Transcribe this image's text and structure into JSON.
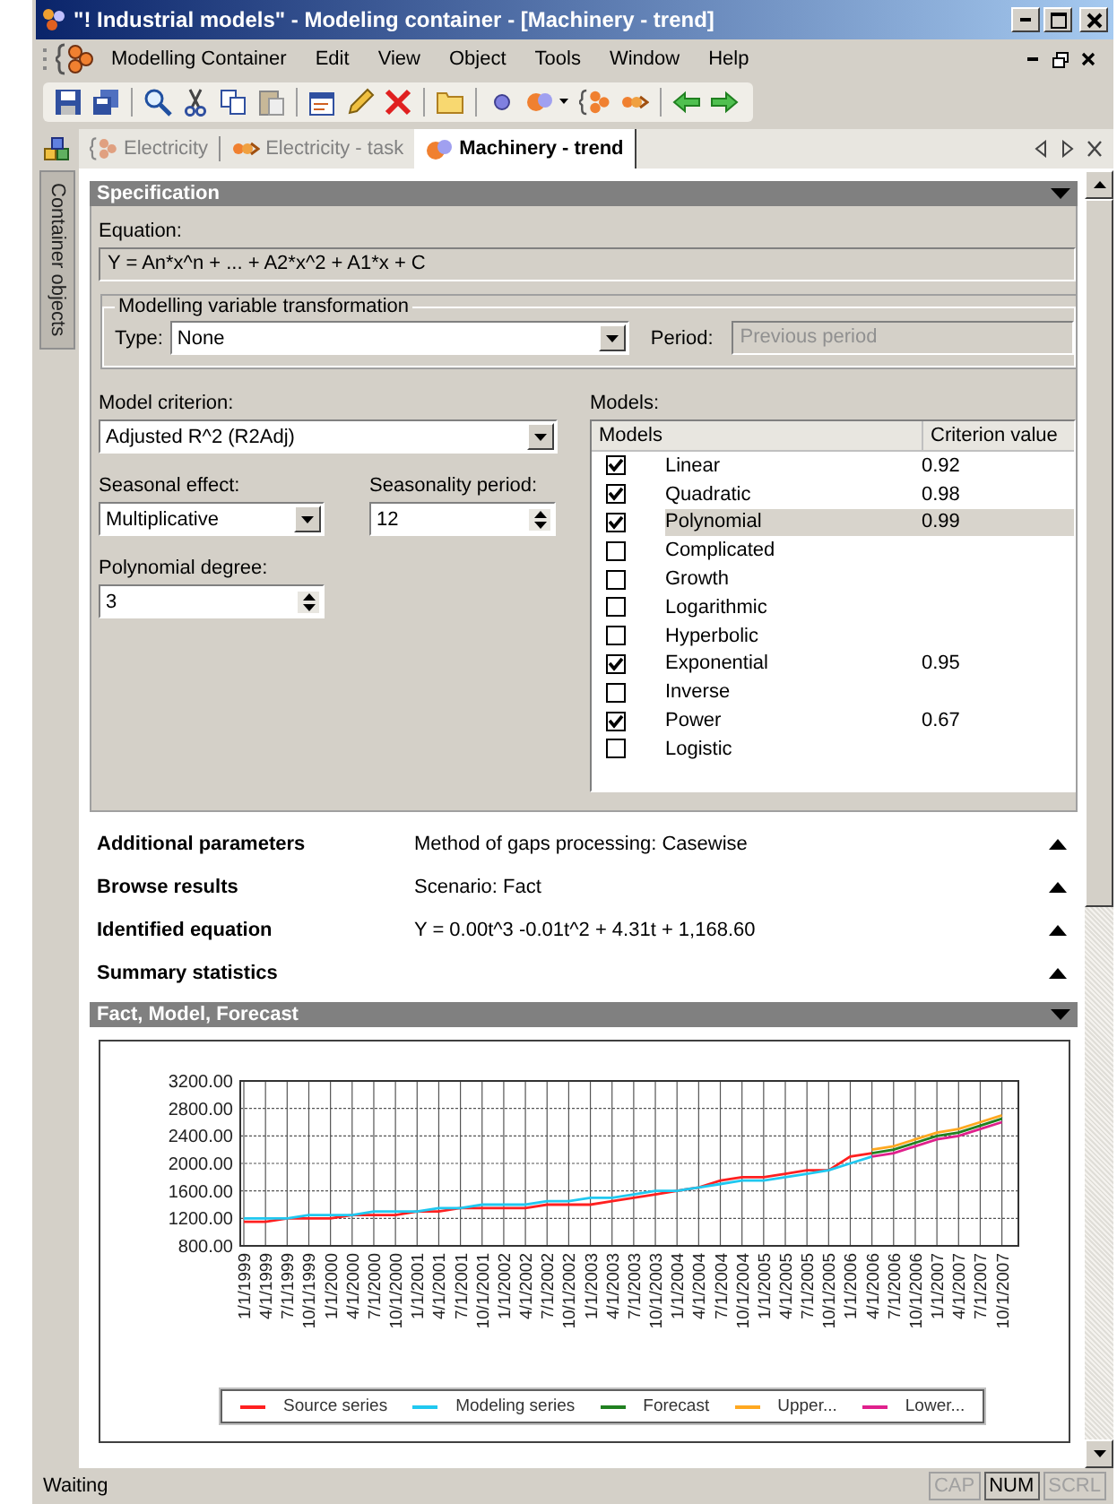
{
  "window": {
    "title": "\"! Industrial models\" - Modeling container - [Machinery - trend]"
  },
  "menu": [
    "Modelling Container",
    "Edit",
    "View",
    "Object",
    "Tools",
    "Window",
    "Help"
  ],
  "side_tab": "Container objects",
  "tabs": [
    {
      "label": "Electricity",
      "selected": false
    },
    {
      "label": "Electricity - task",
      "selected": false
    },
    {
      "label": "Machinery - trend",
      "selected": true
    }
  ],
  "specification": {
    "title": "Specification",
    "equation_label": "Equation:",
    "equation": "Y = An*x^n + ... + A2*x^2 + A1*x + C",
    "transformation": {
      "legend": "Modelling variable transformation",
      "type_label": "Type:",
      "type": "None",
      "period_label": "Period:",
      "period": "Previous period",
      "period_disabled": true
    },
    "criterion_label": "Model criterion:",
    "criterion": "Adjusted R^2 (R2Adj)",
    "seasonal_label": "Seasonal effect:",
    "seasonal": "Multiplicative",
    "seasonality_label": "Seasonality period:",
    "seasonality_period": "12",
    "degree_label": "Polynomial degree:",
    "degree": "3",
    "models_label": "Models:",
    "models_columns": [
      "Models",
      "Criterion value"
    ],
    "models": [
      {
        "name": "Linear",
        "checked": true,
        "selected": false,
        "value": "0.92"
      },
      {
        "name": "Quadratic",
        "checked": true,
        "selected": false,
        "value": "0.98"
      },
      {
        "name": "Polynomial",
        "checked": true,
        "selected": true,
        "value": "0.99"
      },
      {
        "name": "Complicated",
        "checked": false,
        "selected": false
      },
      {
        "name": "Growth",
        "checked": false,
        "selected": false
      },
      {
        "name": "Logarithmic",
        "checked": false,
        "selected": false
      },
      {
        "name": "Hyperbolic",
        "checked": false,
        "selected": false
      },
      {
        "name": "Exponential",
        "checked": true,
        "selected": false,
        "value": "0.95"
      },
      {
        "name": "Inverse",
        "checked": false,
        "selected": false
      },
      {
        "name": "Power",
        "checked": true,
        "selected": false,
        "value": "0.67"
      },
      {
        "name": "Logistic",
        "checked": false,
        "selected": false
      }
    ]
  },
  "sections": [
    {
      "title": "Additional parameters",
      "summary": "Method of gaps processing: Casewise"
    },
    {
      "title": "Browse results",
      "summary": "Scenario: Fact"
    },
    {
      "title": "Identified equation",
      "summary": "Y = 0.00t^3 -0.01t^2 + 4.31t + 1,168.60"
    },
    {
      "title": "Summary statistics"
    }
  ],
  "chart_panel": {
    "title": "Fact, Model, Forecast",
    "chart_data": {
      "type": "line",
      "grid": true,
      "categories": [
        "1/1/1999",
        "4/1/1999",
        "7/1/1999",
        "10/1/1999",
        "1/1/2000",
        "4/1/2000",
        "7/1/2000",
        "10/1/2000",
        "1/1/2001",
        "4/1/2001",
        "7/1/2001",
        "10/1/2001",
        "1/1/2002",
        "4/1/2002",
        "7/1/2002",
        "10/1/2002",
        "1/1/2003",
        "4/1/2003",
        "7/1/2003",
        "10/1/2003",
        "1/1/2004",
        "4/1/2004",
        "7/1/2004",
        "10/1/2004",
        "1/1/2005",
        "4/1/2005",
        "7/1/2005",
        "10/1/2005",
        "1/1/2006",
        "4/1/2006",
        "7/1/2006",
        "10/1/2006",
        "1/1/2007",
        "4/1/2007",
        "7/1/2007",
        "10/1/2007"
      ],
      "ylim": [
        800,
        3200
      ],
      "yticks": [
        {
          "value": 800,
          "label": "800.00"
        },
        {
          "value": 1200,
          "label": "1200.00"
        },
        {
          "value": 1600,
          "label": "1600.00"
        },
        {
          "value": 2000,
          "label": "2000.00"
        },
        {
          "value": 2400,
          "label": "2400.00"
        },
        {
          "value": 2800,
          "label": "2800.00"
        },
        {
          "value": 3200,
          "label": "3200.00"
        }
      ],
      "series": [
        {
          "name": "Source series",
          "color": "#ff2020",
          "values": [
            1150,
            1150,
            1200,
            1200,
            1200,
            1250,
            1250,
            1250,
            1300,
            1300,
            1350,
            1350,
            1350,
            1350,
            1400,
            1400,
            1400,
            1450,
            1500,
            1550,
            1600,
            1650,
            1750,
            1800,
            1800,
            1850,
            1900,
            1900,
            2100,
            2150,
            null,
            null,
            null,
            null,
            null,
            null
          ]
        },
        {
          "name": "Modeling series",
          "color": "#20c8f0",
          "values": [
            1200,
            1200,
            1200,
            1250,
            1250,
            1250,
            1300,
            1300,
            1300,
            1350,
            1350,
            1400,
            1400,
            1400,
            1450,
            1450,
            1500,
            1500,
            1550,
            1600,
            1600,
            1650,
            1700,
            1750,
            1750,
            1800,
            1850,
            1900,
            2000,
            2100,
            null,
            null,
            null,
            null,
            null,
            null
          ]
        },
        {
          "name": "Forecast",
          "color": "#208020",
          "values": [
            null,
            null,
            null,
            null,
            null,
            null,
            null,
            null,
            null,
            null,
            null,
            null,
            null,
            null,
            null,
            null,
            null,
            null,
            null,
            null,
            null,
            null,
            null,
            null,
            null,
            null,
            null,
            null,
            null,
            2150,
            2200,
            2300,
            2400,
            2450,
            2550,
            2650
          ]
        },
        {
          "name": "Upper...",
          "color": "#ffa820",
          "values": [
            null,
            null,
            null,
            null,
            null,
            null,
            null,
            null,
            null,
            null,
            null,
            null,
            null,
            null,
            null,
            null,
            null,
            null,
            null,
            null,
            null,
            null,
            null,
            null,
            null,
            null,
            null,
            null,
            null,
            2200,
            2250,
            2350,
            2450,
            2500,
            2600,
            2700
          ]
        },
        {
          "name": "Lower...",
          "color": "#e0208c",
          "values": [
            null,
            null,
            null,
            null,
            null,
            null,
            null,
            null,
            null,
            null,
            null,
            null,
            null,
            null,
            null,
            null,
            null,
            null,
            null,
            null,
            null,
            null,
            null,
            null,
            null,
            null,
            null,
            null,
            null,
            2100,
            2150,
            2250,
            2350,
            2400,
            2500,
            2600
          ]
        }
      ]
    }
  },
  "status_bar": {
    "text": "Waiting",
    "indicators": [
      {
        "label": "CAP",
        "on": false
      },
      {
        "label": "NUM",
        "on": true
      },
      {
        "label": "SCRL",
        "on": false
      }
    ]
  }
}
